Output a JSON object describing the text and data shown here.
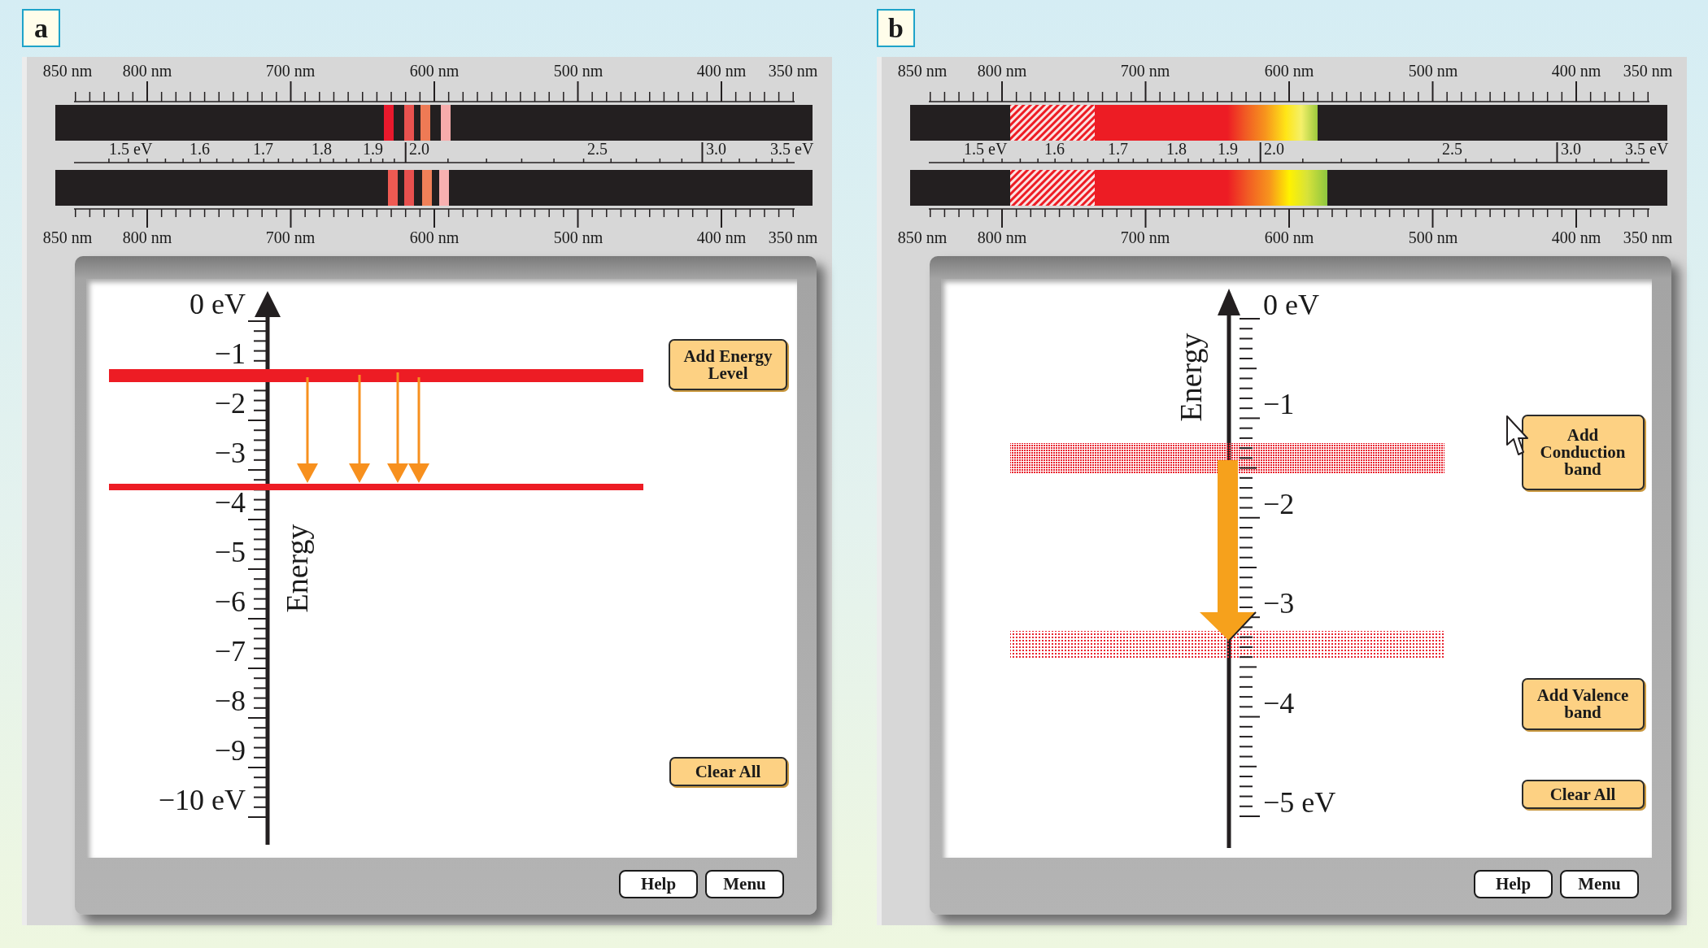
{
  "panels": [
    {
      "label": "a",
      "spectrum": {
        "kind": "lines",
        "top_scale": [
          "850 nm",
          "800 nm",
          "700 nm",
          "600 nm",
          "500 nm",
          "400 nm",
          "350 nm"
        ],
        "energy_scale": [
          "1.5 eV",
          "1.6",
          "1.7",
          "1.8",
          "1.9",
          "2.0",
          "2.5",
          "3.0",
          "3.5 eV"
        ],
        "bottom_scale": [
          "850 nm",
          "800 nm",
          "700 nm",
          "600 nm",
          "500 nm",
          "400 nm",
          "350 nm"
        ]
      },
      "diagram": {
        "kind": "levels",
        "axis_labels": [
          "0 eV",
          "−1",
          "−2",
          "−3",
          "−4",
          "−5",
          "−6",
          "−7",
          "−8",
          "−9",
          "−10 eV"
        ],
        "axis_title": "Energy",
        "buttons": [
          "Add Energy Level",
          "Clear All"
        ]
      },
      "footer_buttons": [
        "Help",
        "Menu"
      ]
    },
    {
      "label": "b",
      "spectrum": {
        "kind": "bands",
        "top_scale": [
          "850 nm",
          "800 nm",
          "700 nm",
          "600 nm",
          "500 nm",
          "400 nm",
          "350 nm"
        ],
        "energy_scale": [
          "1.5 eV",
          "1.6",
          "1.7",
          "1.8",
          "1.9",
          "2.0",
          "2.5",
          "3.0",
          "3.5 eV"
        ],
        "bottom_scale": [
          "850 nm",
          "800 nm",
          "700 nm",
          "600 nm",
          "500 nm",
          "400 nm",
          "350 nm"
        ]
      },
      "diagram": {
        "kind": "bands",
        "axis_labels": [
          "0 eV",
          "−1",
          "−2",
          "−3",
          "−4",
          "−5 eV"
        ],
        "axis_title": "Energy",
        "buttons": [
          "Add Conduction band",
          "Add Valence band",
          "Clear All"
        ]
      },
      "footer_buttons": [
        "Help",
        "Menu"
      ]
    }
  ]
}
